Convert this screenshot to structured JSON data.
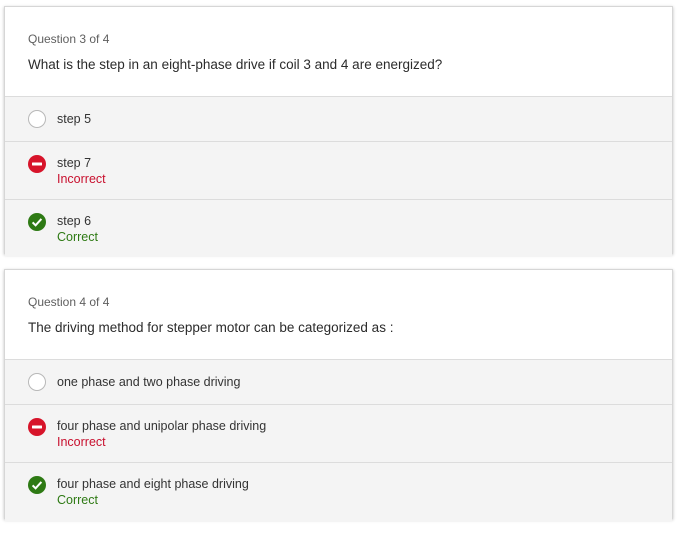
{
  "questions": [
    {
      "number_label": "Question 3 of 4",
      "text": "What is the step in an eight-phase drive if coil 3 and 4 are energized?",
      "options": [
        {
          "label": "step 5",
          "state": "unselected"
        },
        {
          "label": "step 7",
          "state": "incorrect",
          "status": "Incorrect"
        },
        {
          "label": "step 6",
          "state": "correct",
          "status": "Correct"
        }
      ]
    },
    {
      "number_label": "Question 4 of 4",
      "text": "The driving method for stepper motor can be categorized as :",
      "options": [
        {
          "label": "one phase and two phase driving",
          "state": "unselected"
        },
        {
          "label": "four phase and unipolar phase driving",
          "state": "incorrect",
          "status": "Incorrect"
        },
        {
          "label": "four phase and eight phase driving",
          "state": "correct",
          "status": "Correct"
        }
      ]
    }
  ],
  "icons": {
    "incorrect": "minus-circle-icon",
    "correct": "checkmark-circle-icon"
  },
  "colors": {
    "incorrect": "#c8102e",
    "correct": "#2e7a14",
    "option_bg": "#f4f4f4"
  }
}
